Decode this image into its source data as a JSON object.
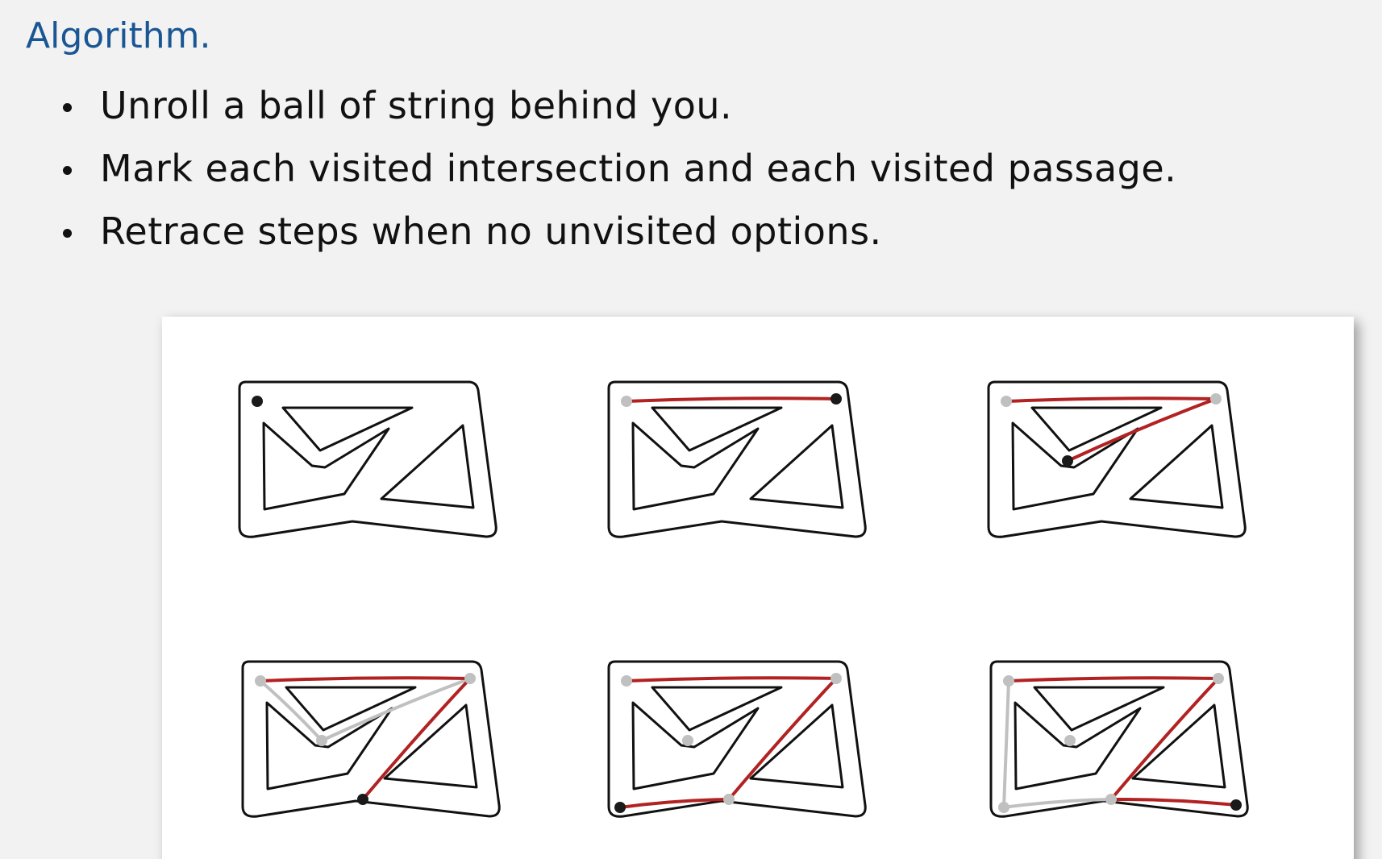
{
  "heading": "Algorithm.",
  "bullets": [
    "Unroll a ball of string behind you.",
    "Mark each visited intersection and each visited passage.",
    "Retrace steps when no unvisited options."
  ],
  "colors": {
    "heading": "#1a5694",
    "string": "#b22222",
    "visited": "#c0c0c0",
    "current": "#1a1a1a",
    "maze_wall": "#111111"
  },
  "figure": {
    "panels": [
      {
        "id": 1,
        "red_path": [],
        "gray_path": [],
        "visited_nodes": [],
        "current_node": "A"
      },
      {
        "id": 2,
        "red_path": [
          "A",
          "B"
        ],
        "gray_path": [],
        "visited_nodes": [
          "A"
        ],
        "current_node": "B"
      },
      {
        "id": 3,
        "red_path": [
          "A",
          "B",
          "C"
        ],
        "gray_path": [],
        "visited_nodes": [
          "A",
          "B"
        ],
        "current_node": "C"
      },
      {
        "id": 4,
        "red_path": [
          "A",
          "B",
          "D"
        ],
        "gray_path": [
          "B",
          "C",
          "A"
        ],
        "visited_nodes": [
          "A",
          "B",
          "C"
        ],
        "current_node": "D"
      },
      {
        "id": 5,
        "red_path": [
          "A",
          "B",
          "D",
          "E"
        ],
        "gray_path": [],
        "visited_nodes": [
          "A",
          "B",
          "C",
          "D"
        ],
        "current_node": "E"
      },
      {
        "id": 6,
        "red_path": [
          "A",
          "B",
          "D",
          "F"
        ],
        "gray_path": [
          "D",
          "G",
          "A"
        ],
        "visited_nodes": [
          "A",
          "B",
          "C",
          "D",
          "G"
        ],
        "current_node": "F"
      }
    ]
  }
}
